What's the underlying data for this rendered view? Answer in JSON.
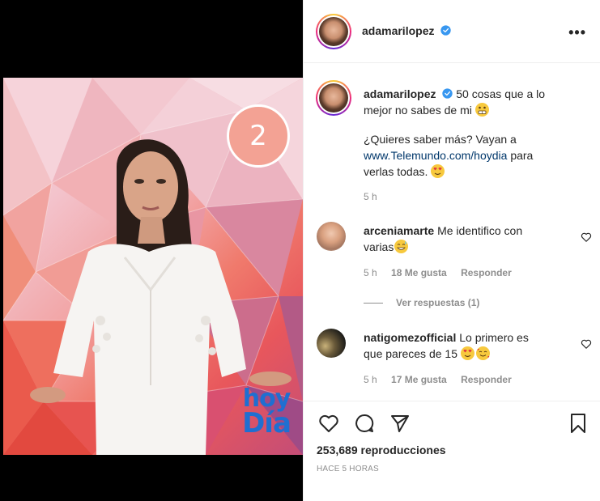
{
  "post": {
    "author": "adamarilopez",
    "verified": true,
    "caption_text": "50 cosas que a lo mejor no sabes de mi",
    "caption_line2": "¿Quieres saber más? Vayan a",
    "caption_link": "www.Telemundo.com/hoydia",
    "caption_line3_a": "para",
    "caption_line3_b": "verlas todas.",
    "caption_time": "5 h"
  },
  "media": {
    "number_badge": "2",
    "logo_line1": "hoy",
    "logo_line2": "Día"
  },
  "comments": [
    {
      "user": "arceniamarte",
      "text_a": "Me identifico con",
      "text_b": "varias",
      "time": "5 h",
      "likes": "18 Me gusta",
      "reply_label": "Responder",
      "view_replies": "Ver respuestas (1)"
    },
    {
      "user": "natigomezofficial",
      "text_a": "Lo primero es",
      "text_b": "que pareces de 15",
      "time": "5 h",
      "likes": "17 Me gusta",
      "reply_label": "Responder"
    }
  ],
  "stats": {
    "views": "253,689 reproducciones",
    "time_ago": "HACE 5 HORAS"
  },
  "colors": {
    "verified": "#3897f0",
    "link": "#00376b",
    "muted": "#8e8e8e",
    "logo_blue": "#1f6fd1"
  }
}
